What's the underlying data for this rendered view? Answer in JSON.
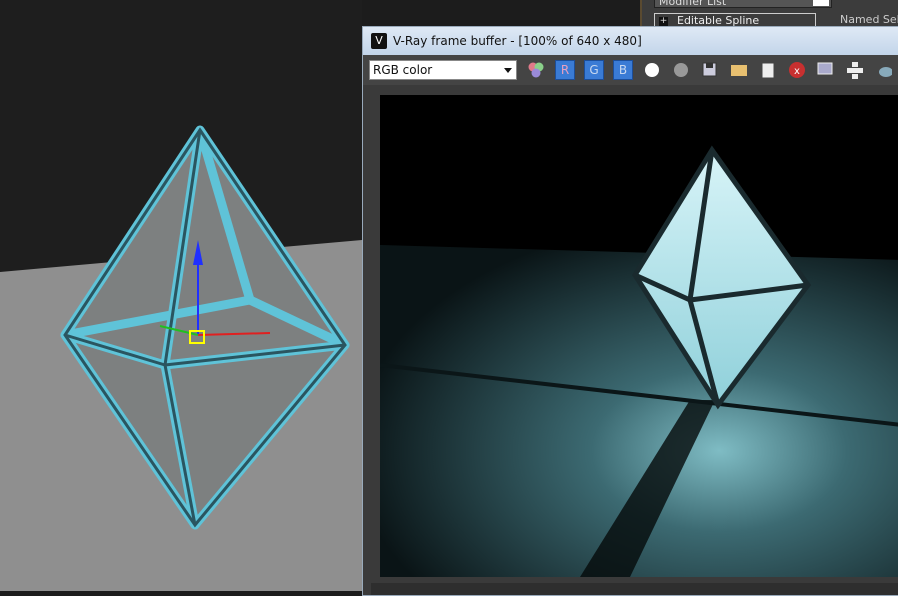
{
  "command_panel": {
    "modifier_list": "Modifier List",
    "stack_item": "Editable Spline",
    "named_selections": "Named Sel"
  },
  "vfb": {
    "title": "V-Ray frame buffer - [100% of 640 x 480]",
    "channel_select": "RGB color",
    "channels": [
      "R",
      "G",
      "B"
    ],
    "accent": "#3a7bd5"
  }
}
